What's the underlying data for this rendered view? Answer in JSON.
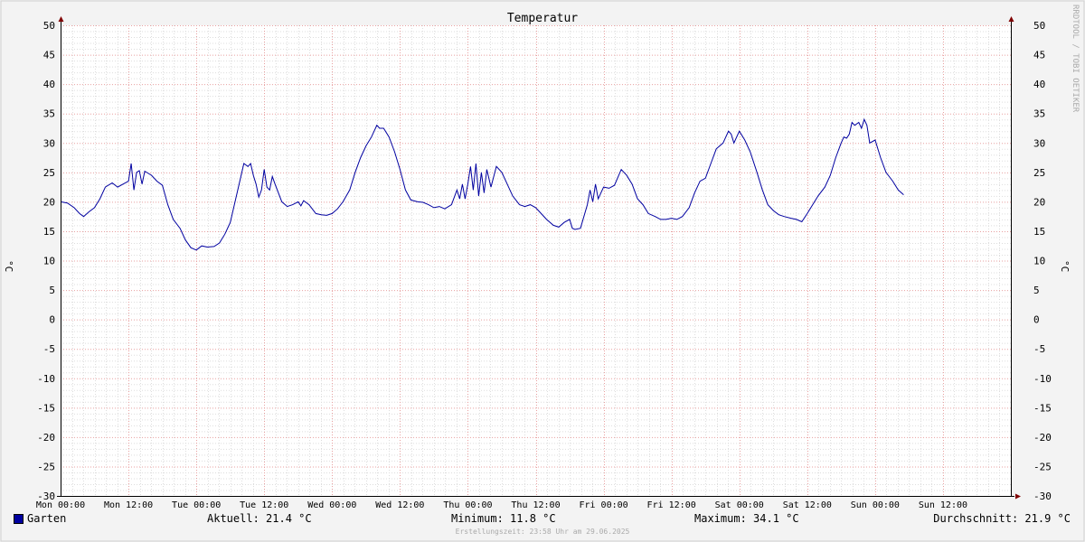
{
  "chart_data": {
    "type": "line",
    "title": "Temperatur",
    "ylabel": "°C",
    "ylim": [
      -30,
      50
    ],
    "yticks": [
      "50",
      "45",
      "40",
      "35",
      "30",
      "25",
      "20",
      "15",
      "10",
      "5",
      "0",
      "-5",
      "-10",
      "-15",
      "-20",
      "-25",
      "-30"
    ],
    "xlim_days": [
      0,
      7
    ],
    "xtick_labels": [
      "Mon 00:00",
      "Mon 12:00",
      "Tue 00:00",
      "Tue 12:00",
      "Wed 00:00",
      "Wed 12:00",
      "Thu 00:00",
      "Thu 12:00",
      "Fri 00:00",
      "Fri 12:00",
      "Sat 00:00",
      "Sat 12:00",
      "Sun 00:00",
      "Sun 12:00"
    ],
    "grid": true,
    "series": [
      {
        "name": "Garten",
        "color": "#0000a0",
        "points": [
          [
            0.0,
            20.0
          ],
          [
            0.05,
            19.8
          ],
          [
            0.1,
            19.0
          ],
          [
            0.14,
            18.0
          ],
          [
            0.17,
            17.5
          ],
          [
            0.21,
            18.3
          ],
          [
            0.25,
            19.0
          ],
          [
            0.29,
            20.5
          ],
          [
            0.33,
            22.5
          ],
          [
            0.38,
            23.2
          ],
          [
            0.42,
            22.5
          ],
          [
            0.46,
            23.0
          ],
          [
            0.5,
            23.5
          ],
          [
            0.52,
            26.5
          ],
          [
            0.54,
            22.0
          ],
          [
            0.56,
            25.0
          ],
          [
            0.58,
            25.3
          ],
          [
            0.6,
            23.0
          ],
          [
            0.62,
            25.2
          ],
          [
            0.67,
            24.5
          ],
          [
            0.71,
            23.5
          ],
          [
            0.75,
            22.8
          ],
          [
            0.79,
            19.5
          ],
          [
            0.83,
            17.0
          ],
          [
            0.88,
            15.5
          ],
          [
            0.92,
            13.5
          ],
          [
            0.96,
            12.2
          ],
          [
            1.0,
            11.8
          ],
          [
            1.04,
            12.5
          ],
          [
            1.08,
            12.3
          ],
          [
            1.13,
            12.4
          ],
          [
            1.17,
            13.0
          ],
          [
            1.21,
            14.5
          ],
          [
            1.25,
            16.5
          ],
          [
            1.29,
            20.5
          ],
          [
            1.33,
            24.5
          ],
          [
            1.35,
            26.5
          ],
          [
            1.38,
            26.0
          ],
          [
            1.4,
            26.5
          ],
          [
            1.42,
            24.5
          ],
          [
            1.44,
            23.0
          ],
          [
            1.46,
            20.8
          ],
          [
            1.48,
            22.0
          ],
          [
            1.5,
            25.5
          ],
          [
            1.52,
            22.5
          ],
          [
            1.54,
            22.0
          ],
          [
            1.56,
            24.3
          ],
          [
            1.58,
            23.0
          ],
          [
            1.63,
            20.0
          ],
          [
            1.67,
            19.2
          ],
          [
            1.71,
            19.5
          ],
          [
            1.75,
            20.0
          ],
          [
            1.77,
            19.3
          ],
          [
            1.79,
            20.2
          ],
          [
            1.83,
            19.5
          ],
          [
            1.88,
            18.0
          ],
          [
            1.92,
            17.8
          ],
          [
            1.96,
            17.7
          ],
          [
            2.0,
            18.0
          ],
          [
            2.04,
            18.8
          ],
          [
            2.08,
            20.0
          ],
          [
            2.13,
            22.0
          ],
          [
            2.17,
            25.0
          ],
          [
            2.21,
            27.5
          ],
          [
            2.25,
            29.5
          ],
          [
            2.29,
            31.0
          ],
          [
            2.33,
            33.0
          ],
          [
            2.35,
            32.5
          ],
          [
            2.38,
            32.5
          ],
          [
            2.42,
            31.0
          ],
          [
            2.46,
            28.5
          ],
          [
            2.5,
            25.5
          ],
          [
            2.54,
            22.0
          ],
          [
            2.58,
            20.3
          ],
          [
            2.63,
            20.0
          ],
          [
            2.67,
            19.9
          ],
          [
            2.71,
            19.5
          ],
          [
            2.75,
            19.0
          ],
          [
            2.79,
            19.2
          ],
          [
            2.83,
            18.8
          ],
          [
            2.88,
            19.5
          ],
          [
            2.92,
            22.0
          ],
          [
            2.94,
            20.5
          ],
          [
            2.96,
            23.0
          ],
          [
            2.98,
            20.5
          ],
          [
            3.0,
            23.0
          ],
          [
            3.02,
            26.0
          ],
          [
            3.04,
            22.0
          ],
          [
            3.06,
            26.5
          ],
          [
            3.08,
            21.0
          ],
          [
            3.1,
            25.0
          ],
          [
            3.12,
            21.5
          ],
          [
            3.14,
            25.5
          ],
          [
            3.17,
            22.5
          ],
          [
            3.21,
            26.0
          ],
          [
            3.25,
            25.0
          ],
          [
            3.29,
            23.0
          ],
          [
            3.33,
            21.0
          ],
          [
            3.38,
            19.5
          ],
          [
            3.42,
            19.2
          ],
          [
            3.46,
            19.5
          ],
          [
            3.5,
            19.0
          ],
          [
            3.54,
            18.0
          ],
          [
            3.58,
            17.0
          ],
          [
            3.63,
            16.0
          ],
          [
            3.67,
            15.7
          ],
          [
            3.71,
            16.5
          ],
          [
            3.75,
            17.0
          ],
          [
            3.77,
            15.5
          ],
          [
            3.79,
            15.3
          ],
          [
            3.83,
            15.5
          ],
          [
            3.88,
            19.5
          ],
          [
            3.9,
            22.0
          ],
          [
            3.92,
            20.0
          ],
          [
            3.94,
            23.0
          ],
          [
            3.96,
            20.5
          ],
          [
            4.0,
            22.5
          ],
          [
            4.04,
            22.3
          ],
          [
            4.08,
            22.8
          ],
          [
            4.13,
            25.5
          ],
          [
            4.15,
            25.0
          ],
          [
            4.17,
            24.5
          ],
          [
            4.21,
            23.0
          ],
          [
            4.25,
            20.5
          ],
          [
            4.29,
            19.5
          ],
          [
            4.33,
            18.0
          ],
          [
            4.38,
            17.5
          ],
          [
            4.42,
            17.0
          ],
          [
            4.46,
            17.0
          ],
          [
            4.5,
            17.2
          ],
          [
            4.54,
            17.0
          ],
          [
            4.58,
            17.5
          ],
          [
            4.63,
            19.0
          ],
          [
            4.67,
            21.5
          ],
          [
            4.71,
            23.5
          ],
          [
            4.75,
            24.0
          ],
          [
            4.79,
            26.5
          ],
          [
            4.83,
            29.0
          ],
          [
            4.88,
            30.0
          ],
          [
            4.92,
            32.0
          ],
          [
            4.94,
            31.5
          ],
          [
            4.96,
            30.0
          ],
          [
            5.0,
            32.0
          ],
          [
            5.04,
            30.5
          ],
          [
            5.08,
            28.5
          ],
          [
            5.13,
            25.0
          ],
          [
            5.17,
            22.0
          ],
          [
            5.21,
            19.5
          ],
          [
            5.25,
            18.5
          ],
          [
            5.29,
            17.8
          ],
          [
            5.33,
            17.5
          ],
          [
            5.38,
            17.2
          ],
          [
            5.42,
            17.0
          ],
          [
            5.46,
            16.6
          ],
          [
            5.5,
            18.0
          ],
          [
            5.54,
            19.5
          ],
          [
            5.58,
            21.0
          ],
          [
            5.63,
            22.5
          ],
          [
            5.67,
            24.5
          ],
          [
            5.71,
            27.5
          ],
          [
            5.75,
            30.0
          ],
          [
            5.77,
            31.0
          ],
          [
            5.79,
            30.8
          ],
          [
            5.81,
            31.5
          ],
          [
            5.83,
            33.5
          ],
          [
            5.85,
            33.0
          ],
          [
            5.88,
            33.5
          ],
          [
            5.9,
            32.5
          ],
          [
            5.92,
            34.0
          ],
          [
            5.94,
            33.0
          ],
          [
            5.96,
            30.0
          ],
          [
            6.0,
            30.5
          ],
          [
            6.04,
            27.5
          ],
          [
            6.08,
            25.0
          ],
          [
            6.13,
            23.5
          ],
          [
            6.17,
            22.0
          ],
          [
            6.21,
            21.2
          ]
        ]
      }
    ]
  },
  "legend": {
    "series_name": "Garten",
    "current": "Aktuell: 21.4 °C",
    "minimum": "Minimum: 11.8 °C",
    "maximum": "Maximum: 34.1 °C",
    "average": "Durchschnitt: 21.9 °C"
  },
  "footer": "Erstellungszeit: 23:58 Uhr am 29.06.2025",
  "watermark": "RRDTOOL / TOBI OETIKER",
  "colors": {
    "background": "#f3f3f3",
    "canvas": "#ffffff",
    "minor_grid": "#dddddd",
    "major_grid": "#e8a0a0",
    "line": "#0000a0",
    "axis_arrow": "#800000"
  }
}
